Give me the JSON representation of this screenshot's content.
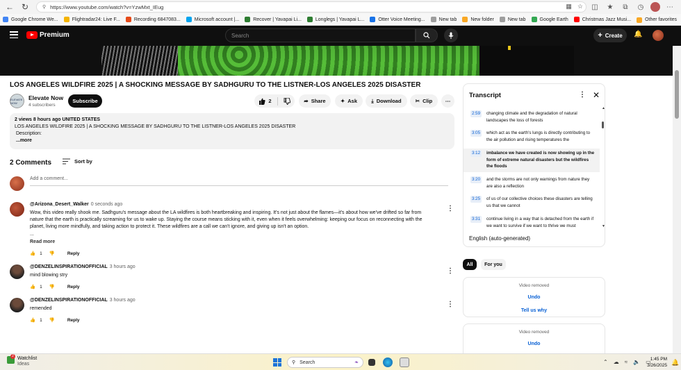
{
  "browser": {
    "url": "https://www.youtube.com/watch?v=YzwMxt_IEug",
    "bookmarks": [
      {
        "label": "Google Chrome We...",
        "color": "#4285f4"
      },
      {
        "label": "Flightradar24: Live F...",
        "color": "#f4b400"
      },
      {
        "label": "Recording 6847083...",
        "color": "#e64a19"
      },
      {
        "label": "Microsoft account |...",
        "color": "#00a4ef"
      },
      {
        "label": "Recover | Yavapai Li...",
        "color": "#2e7d32"
      },
      {
        "label": "Longlegs | Yavapai L...",
        "color": "#2e7d32"
      },
      {
        "label": "Otter Voice Meeting...",
        "color": "#1a73e8"
      },
      {
        "label": "New tab",
        "color": "#9e9e9e"
      },
      {
        "label": "New folder",
        "color": "#f9a825"
      },
      {
        "label": "New tab",
        "color": "#9e9e9e"
      },
      {
        "label": "Google Earth",
        "color": "#34a853"
      },
      {
        "label": "Christmas Jazz Musi...",
        "color": "#ff0000"
      }
    ],
    "other_favorites": "Other favorites"
  },
  "yt_header": {
    "logo": "Premium",
    "search_placeholder": "Search",
    "create": "Create"
  },
  "video": {
    "title": "LOS ANGELES WILDFIRE 2025 | A SHOCKING MESSAGE BY SADHGURU TO THE LISTNER-LOS ANGELES 2025 DISASTER",
    "channel": "Elevate Now",
    "channel_avatar_text": "ELEVATE NOW",
    "subscribers": "4 subscribers",
    "subscribe": "Subscribe",
    "likes": "2",
    "share": "Share",
    "ask": "Ask",
    "download": "Download",
    "clip": "Clip"
  },
  "description": {
    "meta": "2 views  8 hours ago  UNITED STATES",
    "line1": "LOS ANGELES WILDFIRE 2025 | A SHOCKING MESSAGE BY SADHGURU TO THE LISTNER-LOS ANGELES 2025 DISASTER",
    "line2": "Description:",
    "more": "...more"
  },
  "comments": {
    "count_label": "2 Comments",
    "sort_by": "Sort by",
    "add_placeholder": "Add a comment...",
    "reply": "Reply",
    "items": [
      {
        "author": "@Arizona_Desert_Walker",
        "time": "0 seconds ago",
        "text": "Wow, this video really shook me. Sadhguru's message about the LA wildfires is both heartbreaking and inspiring. It's not just about the flames—it's about how we've drifted so far from nature that the earth is practically screaming for us to wake up. Staying the course means sticking with it, even when it feels overwhelming: keeping our focus on reconnecting with the planet, living more mindfully, and taking action to protect it. These wildfires are a call we can't ignore, and giving up isn't an option.",
        "ellipsis": "...",
        "read_more": "Read more",
        "likes": "1"
      },
      {
        "author": "@DENZELINSPIRATIONOFFICIAL",
        "time": "3 hours ago",
        "text": "mind blowing stry",
        "likes": "1"
      },
      {
        "author": "@DENZELINSPIRATIONOFFICIAL",
        "time": "3 hours ago",
        "text": "remended",
        "likes": "1"
      }
    ]
  },
  "transcript": {
    "title": "Transcript",
    "segments": [
      {
        "ts": "2:59",
        "text": "changing climate and the degradation of natural landscapes the loss of forests"
      },
      {
        "ts": "3:05",
        "text": "which act as the earth's lungs is directly contributing to the air pollution and rising temperatures the"
      },
      {
        "ts": "3:12",
        "text": "imbalance we have created is now showing up in the form of extreme natural disasters but the wildfires the floods"
      },
      {
        "ts": "3:20",
        "text": "and the storms are not only warnings from nature they are also a reflection"
      },
      {
        "ts": "3:25",
        "text": "of us of our collective choices these disasters are telling us that we cannot"
      },
      {
        "ts": "3:31",
        "text": "continue living in a way that is detached from the earth if we want to survive if we want to thrive we must"
      }
    ],
    "language": "English (auto-generated)"
  },
  "chips": {
    "all": "All",
    "for_you": "For you"
  },
  "removed_cards": [
    {
      "label": "Video removed",
      "undo": "Undo",
      "tell": "Tell us why"
    },
    {
      "label": "Video removed",
      "undo": "Undo"
    }
  ],
  "taskbar": {
    "widget_title": "Watchlist",
    "widget_sub": "Ideas",
    "widget_badge": "2",
    "search": "Search",
    "time": "1:45 PM",
    "date": "3/26/2025"
  }
}
